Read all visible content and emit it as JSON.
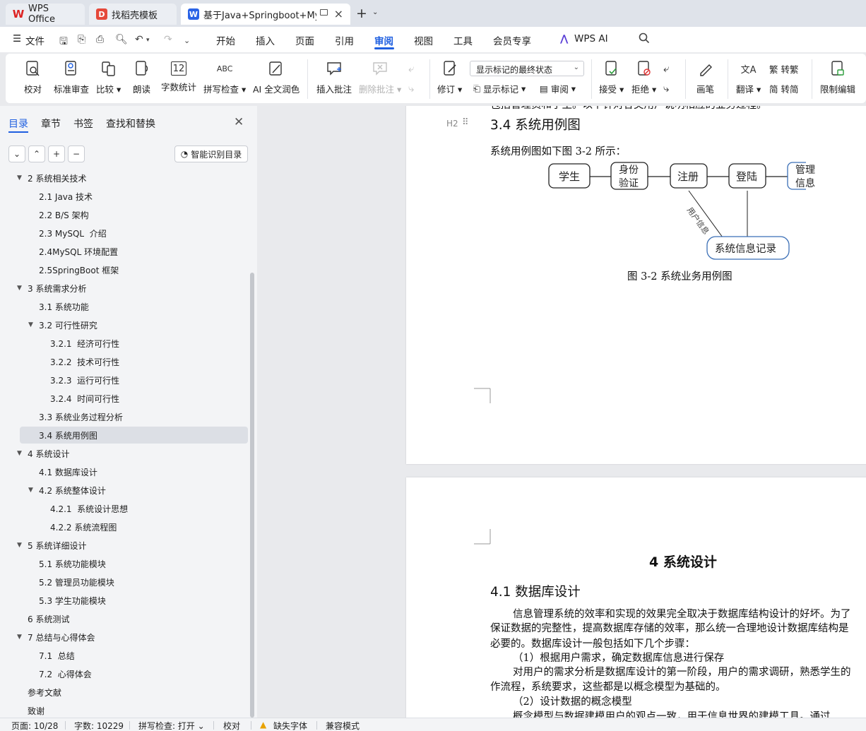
{
  "tabs": [
    {
      "label": "WPS Office",
      "icon": "wps-logo-icon"
    },
    {
      "label": "找稻壳模板",
      "icon": "docer-logo-icon"
    },
    {
      "label": "基于Java+Springboot+MyS",
      "icon": "word-doc-icon"
    }
  ],
  "menu": {
    "file": "文件",
    "items": [
      "开始",
      "插入",
      "页面",
      "引用",
      "审阅",
      "视图",
      "工具",
      "会员专享"
    ],
    "active": "审阅",
    "ai": "WPS AI"
  },
  "ribbon": {
    "proofread": "校对",
    "standard_review": "标准审查",
    "compare": "比较",
    "read_aloud": "朗读",
    "word_count": "字数统计",
    "word_count_icon_text": "12",
    "spell_check": "拼写检查",
    "spell_check_icon_text": "ABC",
    "ai_polish": "AI 全文润色",
    "insert_comment": "插入批注",
    "delete_comment": "删除批注",
    "revise": "修订",
    "markup_state": "显示标记的最终状态",
    "show_markup": "显示标记",
    "review": "审阅",
    "accept": "接受",
    "reject": "拒绝",
    "pen": "画笔",
    "translate": "翻译",
    "to_traditional": "转繁",
    "to_simplified": "转简",
    "restrict_edit": "限制编辑"
  },
  "left_panel": {
    "tabs": [
      "目录",
      "章节",
      "书签",
      "查找和替换"
    ],
    "active_tab": "目录",
    "smart_toc": "智能识别目录",
    "toc": [
      {
        "label": "2 系统相关技术",
        "level": 1,
        "expanded": true
      },
      {
        "label": "2.1 Java 技术",
        "level": 2
      },
      {
        "label": "2.2 B/S 架构",
        "level": 2
      },
      {
        "label": "2.3 MySQL  介绍",
        "level": 2
      },
      {
        "label": "2.4MySQL 环境配置",
        "level": 2
      },
      {
        "label": "2.5SpringBoot 框架",
        "level": 2
      },
      {
        "label": "3 系统需求分析",
        "level": 1,
        "expanded": true
      },
      {
        "label": "3.1 系统功能",
        "level": 2
      },
      {
        "label": "3.2 可行性研究",
        "level": 2,
        "expanded": true
      },
      {
        "label": "3.2.1  经济可行性",
        "level": 3
      },
      {
        "label": "3.2.2  技术可行性",
        "level": 3
      },
      {
        "label": "3.2.3  运行可行性",
        "level": 3
      },
      {
        "label": "3.2.4  时间可行性",
        "level": 3
      },
      {
        "label": "3.3 系统业务过程分析",
        "level": 2
      },
      {
        "label": "3.4 系统用例图",
        "level": 2,
        "selected": true
      },
      {
        "label": "4 系统设计",
        "level": 1,
        "expanded": true
      },
      {
        "label": "4.1 数据库设计",
        "level": 2
      },
      {
        "label": "4.2 系统整体设计",
        "level": 2,
        "expanded": true
      },
      {
        "label": "4.2.1  系统设计思想",
        "level": 3
      },
      {
        "label": "4.2.2 系统流程图",
        "level": 3
      },
      {
        "label": "5 系统详细设计",
        "level": 1,
        "expanded": true
      },
      {
        "label": "5.1 系统功能模块",
        "level": 2
      },
      {
        "label": "5.2 管理员功能模块",
        "level": 2
      },
      {
        "label": "5.3 学生功能模块",
        "level": 2
      },
      {
        "label": "6 系统测试",
        "level": 1
      },
      {
        "label": "7 总结与心得体会",
        "level": 1,
        "expanded": true
      },
      {
        "label": "7.1  总结",
        "level": 2
      },
      {
        "label": "7.2  心得体会",
        "level": 2
      },
      {
        "label": "参考文献",
        "level": 1
      },
      {
        "label": "致谢",
        "level": 1
      }
    ]
  },
  "document": {
    "top_line": "包括管理员和学生。以下针对各类用户说明相应的业务过程。",
    "heading_marker": "H2",
    "section_34": "3.4 系统用例图",
    "intro": "系统用例图如下图 3-2 所示：",
    "diagram": {
      "student": "学生",
      "auth_line1": "身份",
      "auth_line2": "验证",
      "register": "注册",
      "login": "登陆",
      "manage_line1": "管理",
      "manage_line2": "信息",
      "user_info": "用户信息",
      "sys_record": "系统信息记录"
    },
    "caption": "图 3-2  系统业务用例图",
    "chapter4": "4 系统设计",
    "section_41": "4.1 数据库设计",
    "para1": "信息管理系统的效率和实现的效果完全取决于数据库结构设计的好坏。为了",
    "para2": "保证数据的完整性，提高数据库存储的效率，那么统一合理地设计数据库结构是",
    "para3": "必要的。数据库设计一般包括如下几个步骤：",
    "step1": "（1）根据用户需求，确定数据库信息进行保存",
    "para4": "对用户的需求分析是数据库设计的第一阶段，用户的需求调研，熟悉学生的",
    "para5": "作流程，系统要求，这些都是以概念模型为基础的。",
    "step2": "（2）设计数据的概念模型",
    "para6": "概念模型与数据建模用户的观点一致，用于信息世界的建模工具。通过"
  },
  "status": {
    "page": "页面: 10/28",
    "words": "字数: 10229",
    "spell": "拼写检查: 打开",
    "proofread": "校对",
    "missing_font": "缺失字体",
    "compat": "兼容模式"
  }
}
